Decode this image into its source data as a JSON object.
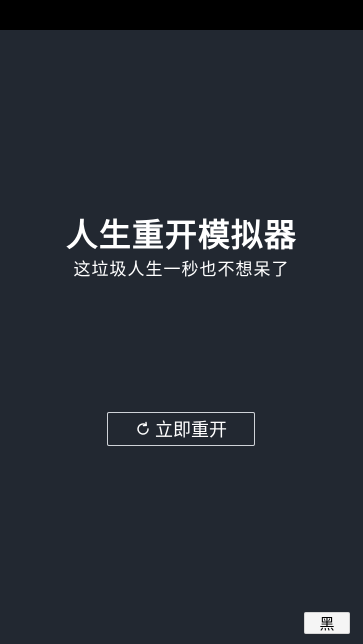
{
  "app": {
    "title": "人生重开模拟器",
    "subtitle": "这垃圾人生一秒也不想呆了"
  },
  "actions": {
    "restart_label": "立即重开",
    "restart_icon": "refresh-icon",
    "theme_toggle_label": "黑"
  },
  "colors": {
    "background": "#222831",
    "text": "#ffffff",
    "button_border": "#cfd3d8",
    "theme_button_bg": "#f5f5f5"
  }
}
